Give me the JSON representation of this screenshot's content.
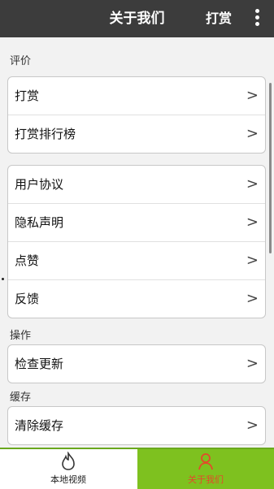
{
  "header": {
    "title": "关于我们",
    "reward_label": "打赏",
    "more_icon": "more-vertical-icon"
  },
  "sections": {
    "rating": {
      "title": "评价",
      "items": [
        "打赏",
        "打赏排行榜"
      ]
    },
    "misc": {
      "items": [
        "用户协议",
        "隐私声明",
        "点赞",
        "反馈"
      ]
    },
    "operation": {
      "title": "操作",
      "items": [
        "检查更新"
      ]
    },
    "cache": {
      "title": "缓存",
      "items": [
        "清除缓存"
      ]
    }
  },
  "chevron": ">",
  "tabs": [
    {
      "label": "本地视频",
      "icon": "flame-icon",
      "active": false
    },
    {
      "label": "关于我们",
      "icon": "person-icon",
      "active": true
    }
  ],
  "colors": {
    "topbar": "#3c3c3c",
    "active_tab_bg": "#7ec11f",
    "active_tab_text": "#e34a2a"
  }
}
